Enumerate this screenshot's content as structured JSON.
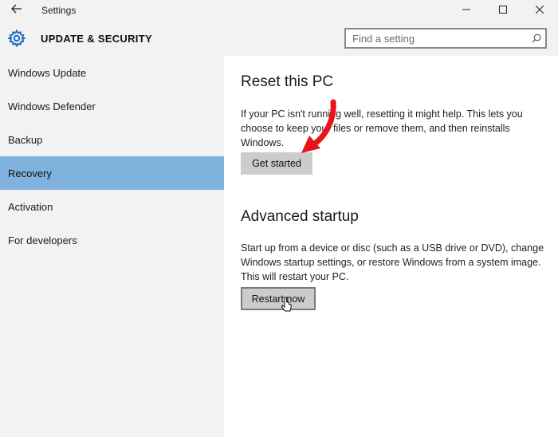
{
  "titlebar": {
    "title": "Settings",
    "back_icon": "back-arrow-icon",
    "minimize_icon": "minimize-icon",
    "maximize_icon": "maximize-icon",
    "close_icon": "close-icon"
  },
  "header": {
    "icon": "gear-icon",
    "title": "UPDATE & SECURITY",
    "search": {
      "placeholder": "Find a setting",
      "value": "",
      "icon": "search-icon"
    }
  },
  "sidebar": {
    "items": [
      {
        "label": "Windows Update",
        "active": false
      },
      {
        "label": "Windows Defender",
        "active": false
      },
      {
        "label": "Backup",
        "active": false
      },
      {
        "label": "Recovery",
        "active": true
      },
      {
        "label": "Activation",
        "active": false
      },
      {
        "label": "For developers",
        "active": false
      }
    ]
  },
  "main": {
    "reset": {
      "heading": "Reset this PC",
      "description": "If your PC isn't running well, resetting it might help. This lets you choose to keep your files or remove them, and then reinstalls Windows.",
      "button_label": "Get started"
    },
    "advanced": {
      "heading": "Advanced startup",
      "description": "Start up from a device or disc (such as a USB drive or DVD), change Windows startup settings, or restore Windows from a system image. This will restart your PC.",
      "button_label": "Restart now"
    }
  },
  "colors": {
    "accent": "#7fb2dc",
    "background": "#f2f2f2",
    "content_background": "#ffffff",
    "button": "#cccccc",
    "annotation_arrow": "#e8141b"
  }
}
